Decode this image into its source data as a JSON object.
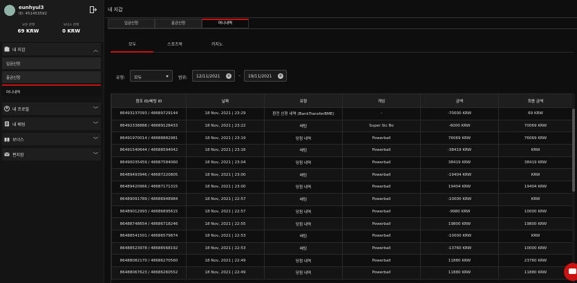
{
  "user": {
    "name": "eunhyul3",
    "id_text": "ID: 451453592",
    "balance_label": "보유 잔액",
    "balance_value": "69 KRW",
    "bonus_label": "보너스 잔액",
    "bonus_value": "0 KRW"
  },
  "sidebar": {
    "wallet": "내 지갑",
    "deposit": "입금신청",
    "withdraw": "출금신청",
    "money_history": "머니내역",
    "profile": "내 프로필",
    "bets": "내 배팅",
    "bonus": "보너스",
    "messages": "편지함"
  },
  "main": {
    "title": "내 지갑",
    "tabs": [
      "입금신청",
      "출금신청",
      "머니내역"
    ],
    "subtabs": [
      "모두",
      "스포츠북",
      "카지노"
    ],
    "filter": {
      "type_label": "유형:",
      "type_value": "모두",
      "range_label": "범위:",
      "from": "12/11/2021",
      "to": "19/11/2021",
      "dash": "–",
      "clear": "×"
    }
  },
  "table": {
    "headers": [
      "참조 ID/베팅 ID",
      "날짜",
      "유형",
      "게임",
      "금액",
      "최종 금액"
    ],
    "rows": [
      [
        "86493237093 / 48689729144",
        "18 Nov, 2021 | 23:29",
        "환전 신청 내역 (BankTransferBME)",
        "-",
        "-70000 KRW",
        "69 KRW"
      ],
      [
        "86492338888 / 48689128433",
        "18 Nov, 2021 | 23:22",
        "배팅",
        "Super Sic Bo",
        "-6000 KRW",
        "70069 KRW"
      ],
      [
        "86491970014 / 48688882981",
        "18 Nov, 2021 | 23:19",
        "당첨 내역",
        "Powerball",
        "76069 KRW",
        "76069 KRW"
      ],
      [
        "86491540644 / 48688594042",
        "18 Nov, 2021 | 23:16",
        "배팅",
        "Powerball",
        "-38419 KRW",
        "KRW"
      ],
      [
        "86490035459 / 48687584060",
        "18 Nov, 2021 | 23:04",
        "당첨 내역",
        "Powerball",
        "38419 KRW",
        "38419 KRW"
      ],
      [
        "86489493946 / 48687220805",
        "18 Nov, 2021 | 23:00",
        "배팅",
        "Powerball",
        "-19404 KRW",
        "KRW"
      ],
      [
        "86489420966 / 48687171315",
        "18 Nov, 2021 | 23:00",
        "당첨 내역",
        "Powerball",
        "19404 KRW",
        "19404 KRW"
      ],
      [
        "86489091789 / 48686948984",
        "18 Nov, 2021 | 22:57",
        "배팅",
        "Powerball",
        "-10000 KRW",
        "KRW"
      ],
      [
        "86489012993 / 48686895615",
        "18 Nov, 2021 | 22:57",
        "당첨 내역",
        "Powerball",
        "-9980 KRW",
        "10000 KRW"
      ],
      [
        "86488748654 / 48686718246",
        "18 Nov, 2021 | 22:55",
        "당첨 내역",
        "Powerball",
        "19800 KRW",
        "19800 KRW"
      ],
      [
        "86488541501 / 48686579874",
        "18 Nov, 2021 | 22:53",
        "배팅",
        "Powerball",
        "-10000 KRW",
        "KRW"
      ],
      [
        "86488523978 / 48686568192",
        "18 Nov, 2021 | 22:53",
        "배팅",
        "Powerball",
        "-13760 KRW",
        "10000 KRW"
      ],
      [
        "86488082170 / 48686270560",
        "18 Nov, 2021 | 22:49",
        "당첨 내역",
        "Powerball",
        "11880 KRW",
        "23760 KRW"
      ],
      [
        "86488067623 / 48686260552",
        "18 Nov, 2021 | 22:49",
        "당첨 내역",
        "Powerball",
        "11880 KRW",
        "11880 KRW"
      ]
    ]
  },
  "icons": {
    "logout": "logout-icon",
    "wallet": "wallet-icon",
    "profile": "user-icon",
    "bets": "receipt-icon",
    "bonus": "gift-icon",
    "messages": "envelope-icon",
    "chat": "chat-icon"
  },
  "colors": {
    "accent": "#cc1111",
    "background": "#0e0e0e"
  }
}
